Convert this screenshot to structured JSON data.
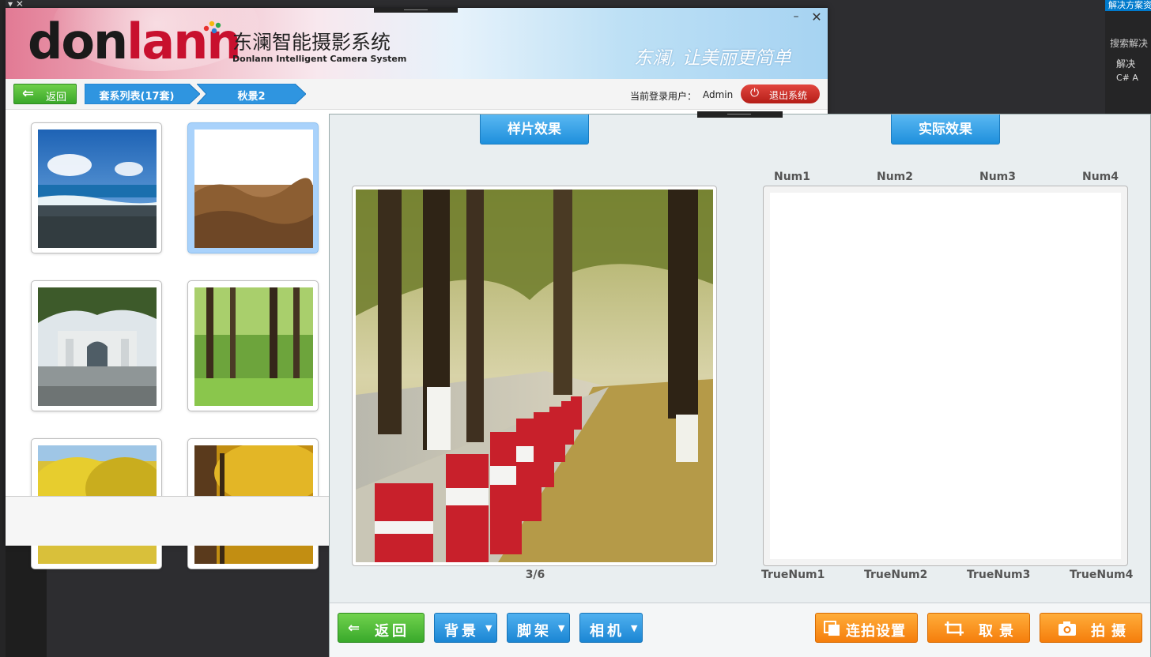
{
  "ide": {
    "right_header": "解决方案资源",
    "search": "搜索解决",
    "row1": "解决",
    "row2": "C# A",
    "left_icons": "▾ ✕"
  },
  "app": {
    "brand_title": "东澜智能摄影系统",
    "brand_subtitle": "Donlann Intelligent Camera System",
    "slogan": "东澜, 让美丽更简单",
    "nav": {
      "back_label": "返回",
      "crumb1": "套系列表(17套)",
      "crumb2": "秋景2",
      "user_label": "当前登录用户：",
      "user_value": "Admin",
      "logout_label": "退出系统"
    },
    "thumbnails": [
      {
        "name": "beach"
      },
      {
        "name": "field"
      },
      {
        "name": "gate"
      },
      {
        "name": "forest"
      },
      {
        "name": "ginkgo"
      },
      {
        "name": "autumn-tree"
      }
    ],
    "selected_thumbnail_index": 1
  },
  "preview": {
    "tab_sample": "样片效果",
    "tab_actual": "实际效果",
    "counter": "3/6",
    "top_labels": [
      "Num1",
      "Num2",
      "Num3",
      "Num4"
    ],
    "bottom_labels": [
      "TrueNum1",
      "TrueNum2",
      "TrueNum3",
      "TrueNum4"
    ],
    "toolbar": {
      "back": "返回",
      "background": "背景",
      "tripod": "脚架",
      "camera": "相机",
      "burst": "连拍设置",
      "framing": "取景",
      "shoot": "拍摄"
    }
  },
  "colors": {
    "accent_blue": "#1e8fdc",
    "accent_green": "#3aa82a",
    "accent_orange": "#f57e0c",
    "logout_red": "#b51e18",
    "selection": "#a9d2fb"
  }
}
